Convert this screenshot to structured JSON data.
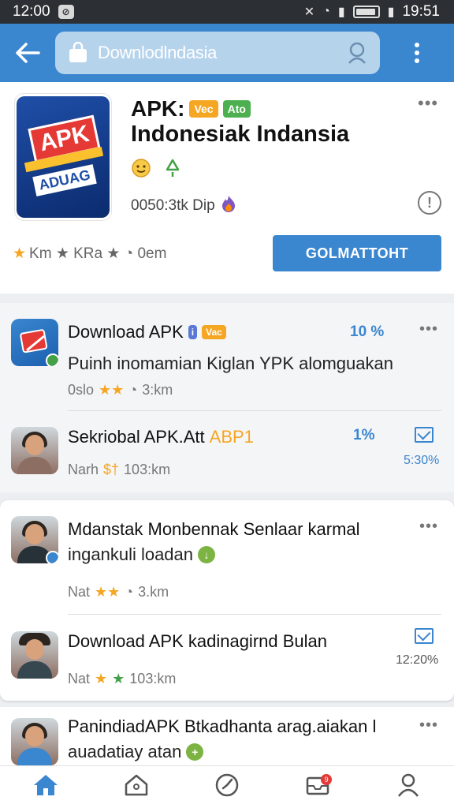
{
  "status_bar": {
    "time": "12:00",
    "right_time": "19:51"
  },
  "app_bar": {
    "search_text": "Downlodlndasia"
  },
  "header": {
    "apk_label": "APK:",
    "badge_orange": "Vec",
    "badge_green": "Ato",
    "app_name": "Indonesiak Indansia",
    "meta_text": "0050:3tk Dip",
    "rating_text": "Km ★ KRa ★ ◔ 0em",
    "install_button": "GOLMATTOHT"
  },
  "list": [
    {
      "title": "Download APK",
      "chip": "Vac",
      "subtitle": "Puinh inomamian Kiglan YPK alomguakan",
      "meta": "0slo",
      "meta_distance": "3:km",
      "percent": "10 %"
    },
    {
      "title": "Sekriobal APK.Att",
      "chip": "ABP1",
      "meta": "Narh",
      "meta_distance": "103:km",
      "percent": "1%",
      "right_percent": "5:30%"
    },
    {
      "title": "Mdanstak Monbennak Senlaar karmal",
      "subtitle": "ingankuli loadan",
      "meta": "Nat",
      "meta_distance": "3.km"
    },
    {
      "title": "Download APK kadinagirnd Bulan",
      "meta": "Nat",
      "meta_distance": "103:km",
      "right_percent": "12:20%"
    },
    {
      "title": "PanindiadAPK Btkadhanta arag.aiakan l",
      "subtitle": "auadatiay atan"
    }
  ],
  "colors": {
    "primary": "#3a86cf",
    "status_bar": "#2c2f33",
    "accent_orange": "#f5a623",
    "accent_green": "#43a047"
  }
}
